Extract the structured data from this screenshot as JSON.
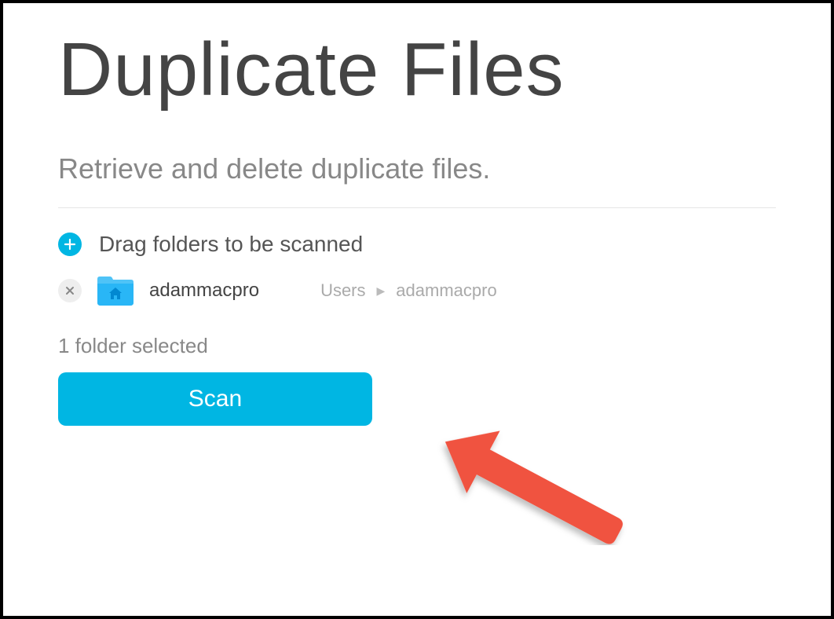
{
  "header": {
    "title": "Duplicate Files",
    "subtitle": "Retrieve and delete duplicate files."
  },
  "dragArea": {
    "label": "Drag folders to be scanned"
  },
  "folders": [
    {
      "name": "adammacpro",
      "breadcrumb": [
        "Users",
        "adammacpro"
      ]
    }
  ],
  "status": "1 folder selected",
  "actions": {
    "scan_label": "Scan"
  },
  "colors": {
    "accent": "#00b6e3",
    "annotation": "#f05340"
  }
}
